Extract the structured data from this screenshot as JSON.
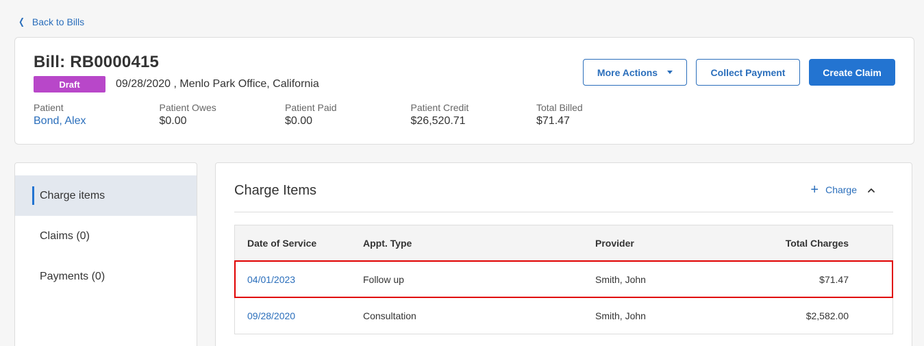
{
  "nav": {
    "back_label": "Back to Bills"
  },
  "bill": {
    "title": "Bill: RB0000415",
    "status": "Draft",
    "meta": "09/28/2020 , Menlo Park Office, California",
    "summary": [
      {
        "label": "Patient",
        "value": "Bond, Alex"
      },
      {
        "label": "Patient Owes",
        "value": "$0.00"
      },
      {
        "label": "Patient Paid",
        "value": "$0.00"
      },
      {
        "label": "Patient Credit",
        "value": "$26,520.71"
      },
      {
        "label": "Total Billed",
        "value": "$71.47"
      }
    ],
    "actions": {
      "more_actions": "More Actions",
      "collect_payment": "Collect Payment",
      "create_claim": "Create Claim"
    }
  },
  "sidebar": {
    "items": [
      {
        "label": "Charge items"
      },
      {
        "label": "Claims (0)"
      },
      {
        "label": "Payments (0)"
      }
    ]
  },
  "charges": {
    "title": "Charge Items",
    "add_label": "Charge",
    "columns": [
      "Date of Service",
      "Appt. Type",
      "Provider",
      "Total Charges"
    ],
    "rows": [
      {
        "date": "04/01/2023",
        "type": "Follow up",
        "provider": "Smith, John",
        "total": "$71.47"
      },
      {
        "date": "09/28/2020",
        "type": "Consultation",
        "provider": "Smith, John",
        "total": "$2,582.00"
      }
    ]
  },
  "colors": {
    "accent": "#2374d1",
    "link": "#2a6ebb",
    "draft_badge": "#b847c9",
    "highlight": "#e00000"
  }
}
